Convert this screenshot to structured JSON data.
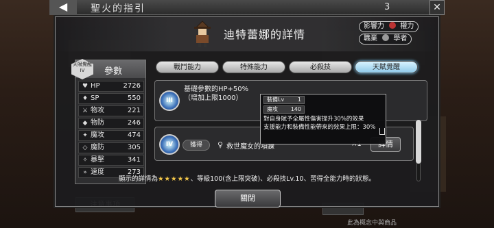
{
  "background": {
    "back_glyph": "◀",
    "title": "聖火的指引",
    "count": "3",
    "close_glyph": "✕",
    "left_button": "注意事項",
    "footer_note": "此為概念中與商品"
  },
  "modal": {
    "title": "迪特蕾娜的詳情",
    "tags": [
      {
        "label": "影響力",
        "icon": "power-icon",
        "value": "權力",
        "color": "#c8c8c8"
      },
      {
        "label": "職業",
        "icon": "scholar-icon",
        "value": "學者",
        "color": "#c8c8c8"
      }
    ],
    "params": {
      "badge": "天賦覺醒 IV",
      "title": "參數",
      "stats": [
        {
          "label": "HP",
          "icon": "heart-icon",
          "glyph": "♥",
          "value": "2726"
        },
        {
          "label": "SP",
          "icon": "flame-icon",
          "glyph": "♦",
          "value": "550"
        },
        {
          "label": "物攻",
          "icon": "sword-icon",
          "glyph": "⚔",
          "value": "221"
        },
        {
          "label": "物防",
          "icon": "shield-icon",
          "glyph": "◆",
          "value": "246"
        },
        {
          "label": "魔攻",
          "icon": "staff-icon",
          "glyph": "✦",
          "value": "474"
        },
        {
          "label": "魔防",
          "icon": "magic-shield-icon",
          "glyph": "◇",
          "value": "305"
        },
        {
          "label": "暴擊",
          "icon": "crit-icon",
          "glyph": "✧",
          "value": "341"
        },
        {
          "label": "速度",
          "icon": "speed-icon",
          "glyph": "»",
          "value": "273"
        }
      ]
    },
    "tabs": [
      "戰鬥能力",
      "特殊能力",
      "必殺技",
      "天賦覺醒"
    ],
    "active_tab": 3,
    "rows": [
      {
        "icon_label": "III",
        "text_line1": "基礎參數的HP+50%",
        "text_line2": "（增加上限1000）"
      },
      {
        "icon_label": "IV",
        "acquire": "獲得",
        "item": "救世魔女的項鍊",
        "qty": "×1",
        "detail": "詳情"
      }
    ],
    "tooltip": {
      "row1_label": "裝備Lv",
      "row1_value": "1",
      "row2_label": "魔攻",
      "row2_value": "140",
      "line1": "對自身賦予全屬性傷害提升30%的效果",
      "line2": "支援能力和裝備性能帶來的效果上限：30%"
    },
    "note_prefix": "顯示的詳情為",
    "note_stars": "★★★★★",
    "note_suffix": "、等級100(含上限突破)、必殺技Lv.10、習得全能力時的狀態。",
    "close_label": "關閉"
  }
}
